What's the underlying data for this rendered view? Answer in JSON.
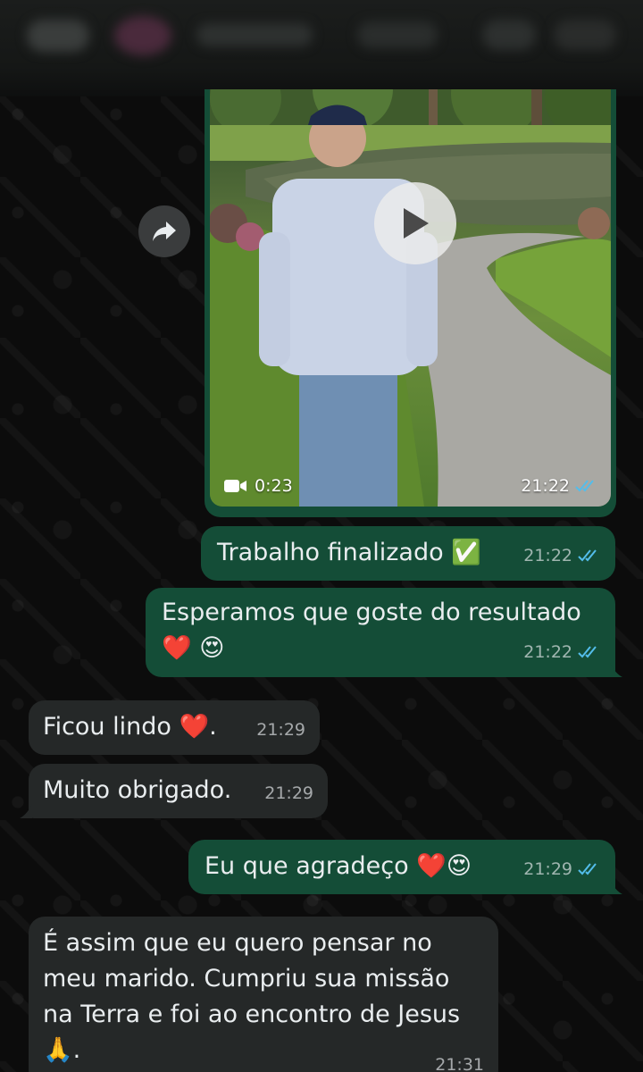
{
  "colors": {
    "outgoing_bubble": "#144d37",
    "incoming_bubble": "#252828",
    "read_ticks": "#53bdeb",
    "background": "#0c0c0c"
  },
  "forward_icon": "forward-arrow-icon",
  "video": {
    "duration": "0:23",
    "time": "21:22",
    "icons": [
      "video-camera-icon",
      "play-icon",
      "double-check-icon"
    ]
  },
  "messages": [
    {
      "direction": "out",
      "text": "Trabalho finalizado ✅",
      "time": "21:22",
      "status": "read"
    },
    {
      "direction": "out",
      "text": "Esperamos que goste do resultado",
      "emoji_line": "❤️ 😍",
      "time": "21:22",
      "status": "read"
    },
    {
      "direction": "in",
      "text": "Ficou lindo ❤️.",
      "time": "21:29"
    },
    {
      "direction": "in",
      "text": "Muito obrigado.",
      "time": "21:29"
    },
    {
      "direction": "out",
      "text": "Eu que agradeço ❤️😍",
      "time": "21:29",
      "status": "read"
    },
    {
      "direction": "in",
      "lines": [
        "É assim que eu quero pensar no",
        "meu marido. Cumpriu sua missão",
        "na Terra e foi ao encontro de Jesus",
        "🙏."
      ],
      "time": "21:31"
    }
  ]
}
